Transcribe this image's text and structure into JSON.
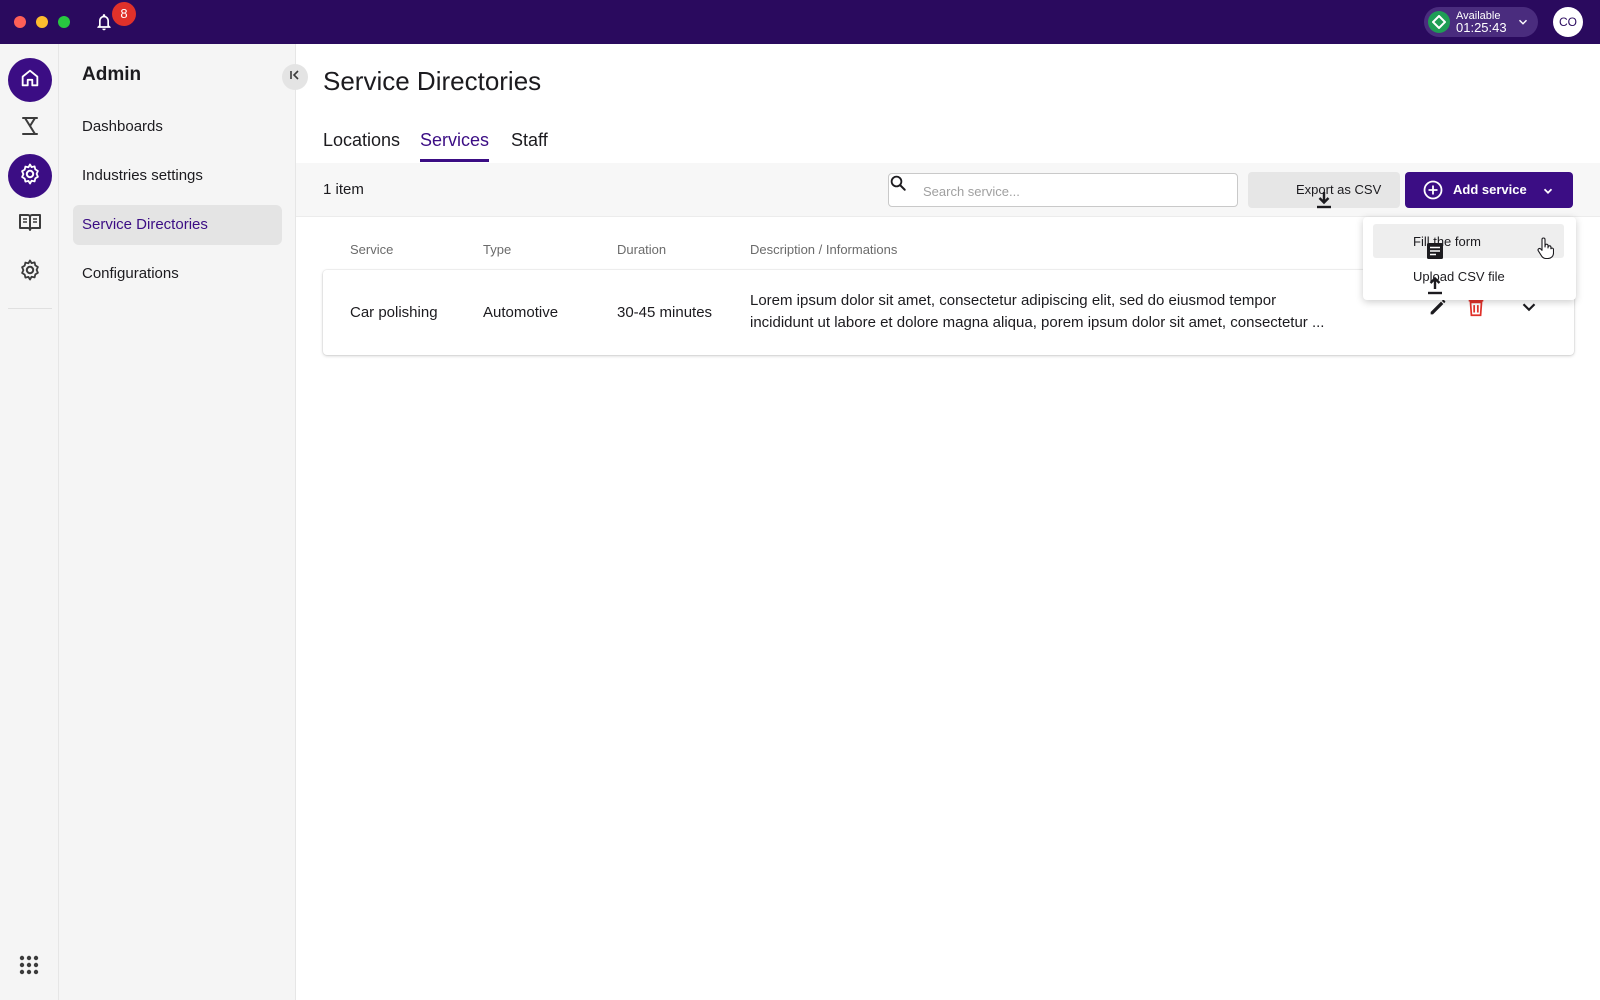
{
  "topbar": {
    "notification_count": "8",
    "status_label": "Available",
    "status_time": "01:25:43",
    "avatar_initials": "CO"
  },
  "sidebar": {
    "title": "Admin",
    "items": [
      {
        "label": "Dashboards",
        "active": false
      },
      {
        "label": "Industries settings",
        "active": false
      },
      {
        "label": "Service Directories",
        "active": true
      },
      {
        "label": "Configurations",
        "active": false
      }
    ]
  },
  "main": {
    "page_title": "Service Directories",
    "tabs": [
      {
        "label": "Locations",
        "active": false
      },
      {
        "label": "Services",
        "active": true
      },
      {
        "label": "Staff",
        "active": false
      }
    ],
    "toolbar": {
      "item_count": "1 item",
      "search_placeholder": "Search service...",
      "export_label": "Export as CSV",
      "add_label": "Add service"
    },
    "table": {
      "columns": [
        "Service",
        "Type",
        "Duration",
        "Description / Informations"
      ],
      "rows": [
        {
          "service": "Car polishing",
          "type": "Automotive",
          "duration": "30-45 minutes",
          "description_line1": "Lorem ipsum dolor sit amet, consectetur adipiscing elit, sed do eiusmod tempor",
          "description_line2": "incididunt ut labore et dolore magna aliqua, porem ipsum dolor sit amet, consectetur ..."
        }
      ]
    },
    "add_menu": {
      "items": [
        {
          "label": "Fill the form",
          "icon": "form-icon"
        },
        {
          "label": "Upload CSV file",
          "icon": "upload-icon"
        }
      ]
    }
  },
  "colors": {
    "brand": "#3b0d84",
    "topbar": "#2a0a5e",
    "danger": "#e0312a",
    "status_green": "#1f9d55"
  }
}
